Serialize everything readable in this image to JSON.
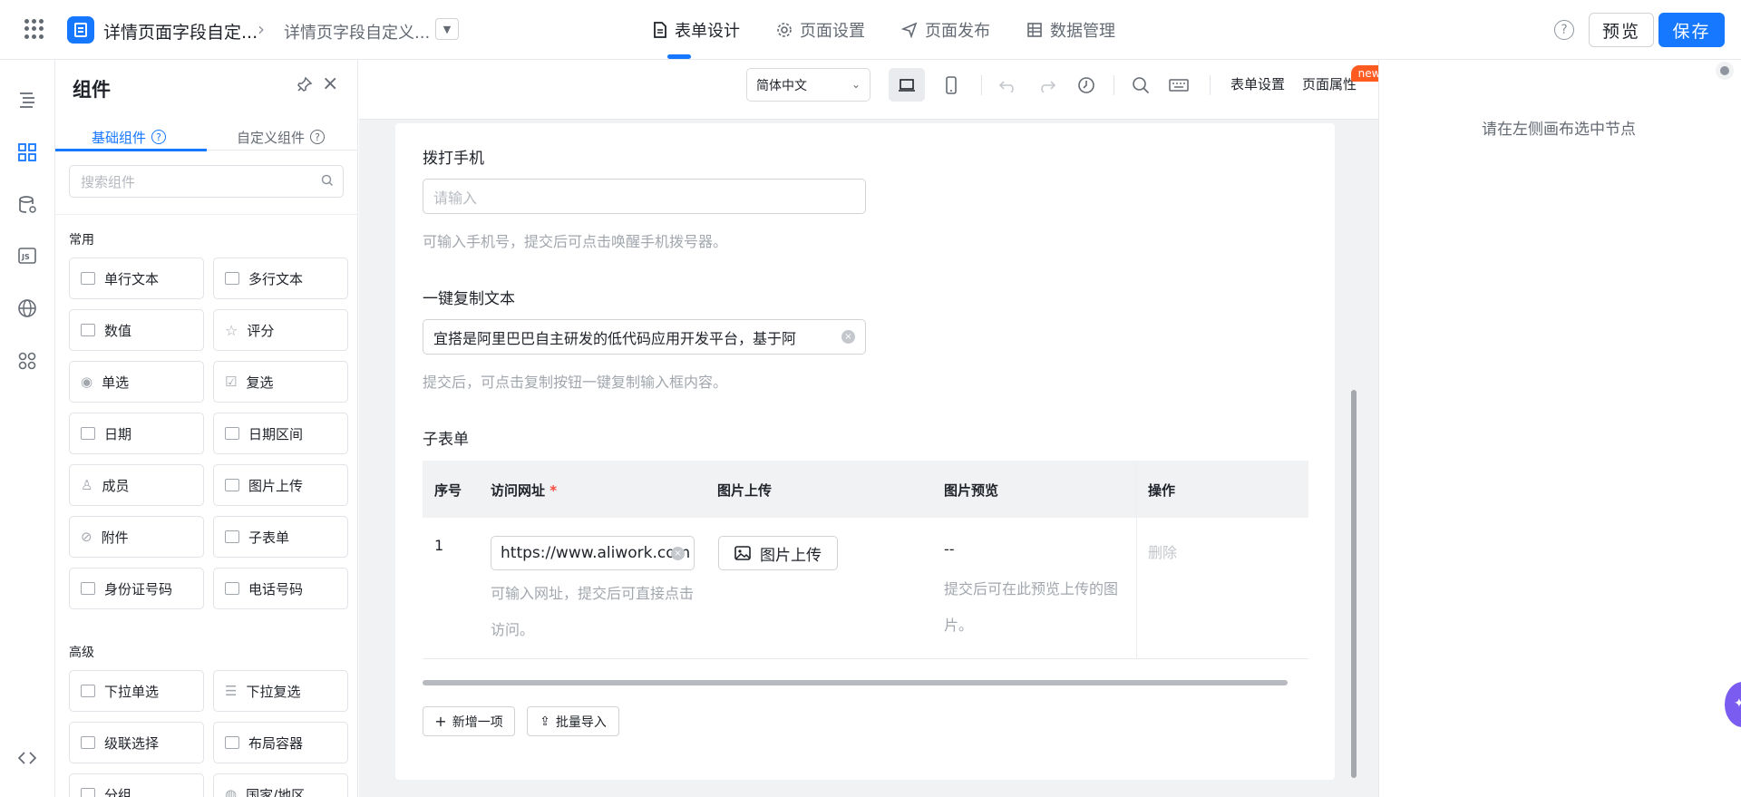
{
  "header": {
    "app_title": "详情页面字段自定...",
    "sub_title": "详情页字段自定义...",
    "tabs": [
      {
        "label": "表单设计",
        "icon": "document-icon",
        "active": true
      },
      {
        "label": "页面设置",
        "icon": "gear-icon",
        "active": false
      },
      {
        "label": "页面发布",
        "icon": "send-icon",
        "active": false
      },
      {
        "label": "数据管理",
        "icon": "table-icon",
        "active": false
      }
    ],
    "help": "?",
    "preview_label": "预览",
    "save_label": "保存"
  },
  "panel": {
    "title": "组件",
    "tabs": [
      "基础组件",
      "自定义组件"
    ],
    "search_placeholder": "搜索组件",
    "sections": [
      {
        "title": "常用",
        "items": [
          "单行文本",
          "多行文本",
          "数值",
          "评分",
          "单选",
          "复选",
          "日期",
          "日期区间",
          "成员",
          "图片上传",
          "附件",
          "子表单",
          "身份证号码",
          "电话号码"
        ]
      },
      {
        "title": "高级",
        "items": [
          "下拉单选",
          "下拉复选",
          "级联选择",
          "布局容器",
          "分组",
          "国家/地区"
        ]
      }
    ]
  },
  "toolbar": {
    "language": "简体中文",
    "form_settings": "表单设置",
    "page_props": "页面属性",
    "new_badge": "new"
  },
  "form": {
    "phone": {
      "label": "拨打手机",
      "placeholder": "请输入",
      "help": "可输入手机号，提交后可点击唤醒手机拨号器。"
    },
    "copy": {
      "label": "一键复制文本",
      "value": "宜搭是阿里巴巴自主研发的低代码应用开发平台，基于阿",
      "help": "提交后，可点击复制按钮一键复制输入框内容。"
    },
    "subform": {
      "label": "子表单",
      "columns": [
        "序号",
        "访问网址",
        "图片上传",
        "图片预览",
        "操作"
      ],
      "required_mark": "*",
      "row": {
        "index": "1",
        "url_value": "https://www.aliwork.com",
        "url_help": "可输入网址，提交后可直接点击访问。",
        "upload_label": "图片上传",
        "preview_value": "--",
        "preview_help": "提交后可在此预览上传的图片。",
        "action": "删除"
      },
      "add_label": "新增一项",
      "import_label": "批量导入"
    }
  },
  "settings": {
    "hint": "请在左侧画布选中节点"
  },
  "colors": {
    "primary": "#1677ff",
    "badge": "#ff5a1f",
    "required": "#f5483b"
  }
}
